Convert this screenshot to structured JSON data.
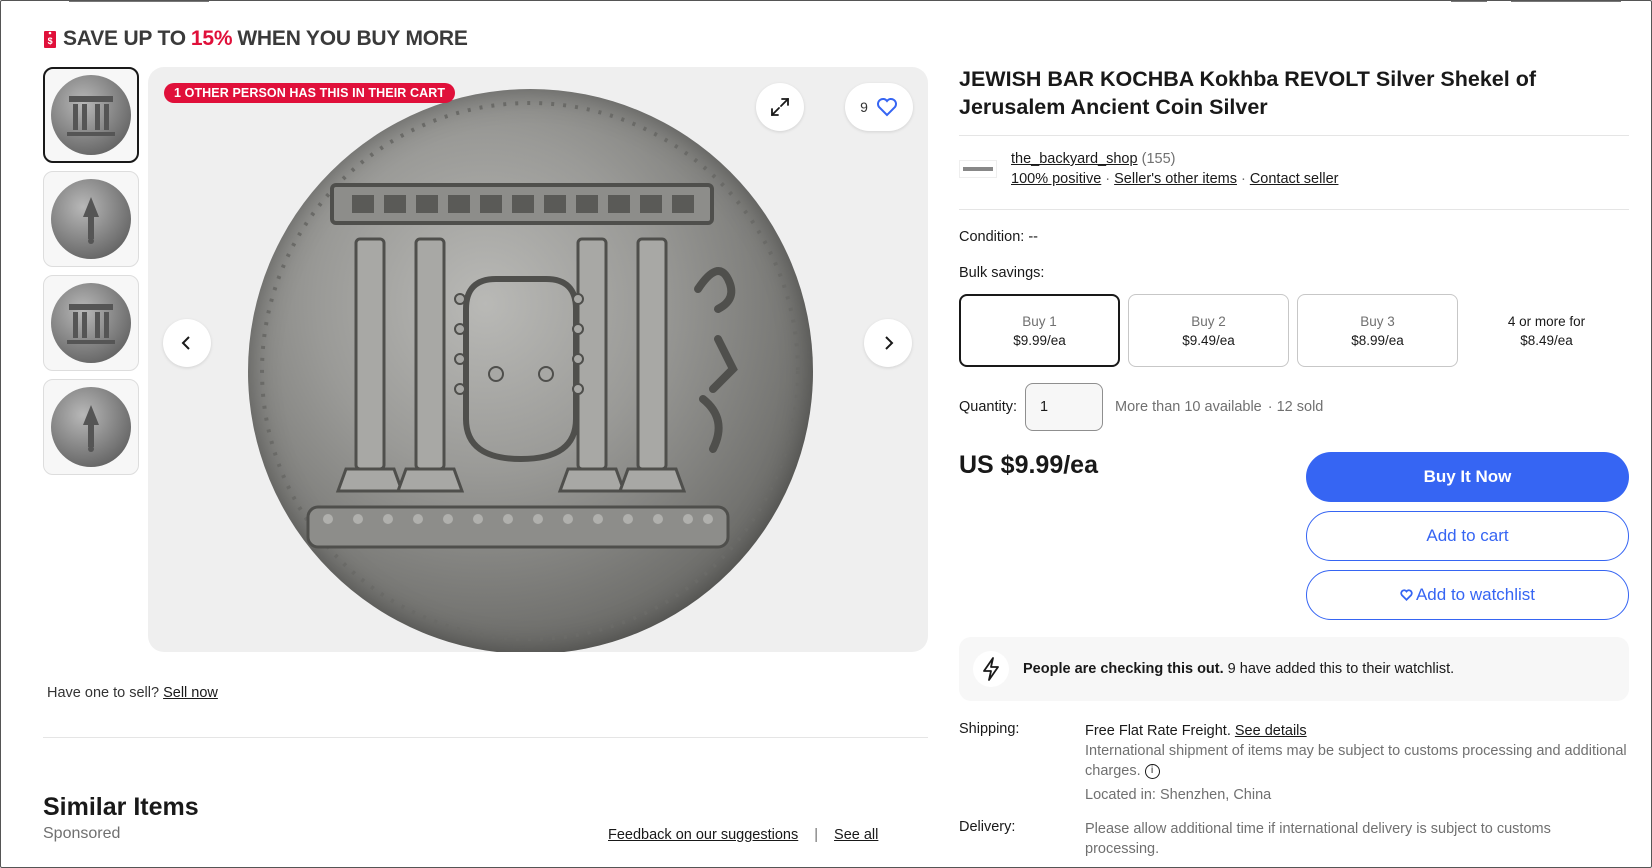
{
  "promo": {
    "prefix": "SAVE UP TO",
    "percent": "15%",
    "suffix": "WHEN YOU BUY MORE"
  },
  "gallery": {
    "thumbnails": [
      "coin-obverse-temple",
      "coin-reverse-lulav",
      "coin-obverse-temple",
      "coin-reverse-lulav"
    ],
    "selected_index": 0,
    "cart_badge": "1 OTHER PERSON HAS THIS IN THEIR CART",
    "watch_count": "9"
  },
  "sell": {
    "prompt": "Have one to sell?",
    "link": "Sell now"
  },
  "similar": {
    "title": "Similar Items",
    "sponsored": "Sponsored",
    "feedback_link": "Feedback on our suggestions",
    "separator": "|",
    "see_all": "See all"
  },
  "listing": {
    "title": "JEWISH BAR KOCHBA Kokhba REVOLT Silver Shekel of Jerusalem Ancient Coin Silver",
    "seller": {
      "name": "the_backyard_shop",
      "count": "(155)",
      "positive": "100% positive",
      "other_items": "Seller's other items",
      "contact": "Contact seller"
    },
    "condition_label": "Condition:",
    "condition_value": "--",
    "bulk_label": "Bulk savings:",
    "bulk_options": [
      {
        "qty": "Buy 1",
        "price": "$9.99/ea"
      },
      {
        "qty": "Buy 2",
        "price": "$9.49/ea"
      },
      {
        "qty": "Buy 3",
        "price": "$8.99/ea"
      },
      {
        "qty": "4 or more for",
        "price": "$8.49/ea"
      }
    ],
    "quantity_label": "Quantity:",
    "quantity_value": "1",
    "available": "More than 10 available",
    "sold": "· 12 sold",
    "price": "US $9.99/ea",
    "buy_now": "Buy It Now",
    "add_to_cart": "Add to cart",
    "add_to_watchlist": "Add to watchlist",
    "checking_bold": "People are checking this out.",
    "checking_rest": "9 have added this to their watchlist.",
    "shipping_label": "Shipping:",
    "shipping_value": "Free Flat Rate Freight.",
    "shipping_link": "See details",
    "shipping_note": "International shipment of items may be subject to customs processing and additional charges.",
    "located": "Located in: Shenzhen, China",
    "delivery_label": "Delivery:",
    "delivery_value": "Please allow additional time if international delivery is subject to customs processing."
  },
  "colors": {
    "accent": "#3665f3",
    "promo_red": "#e0103a"
  }
}
